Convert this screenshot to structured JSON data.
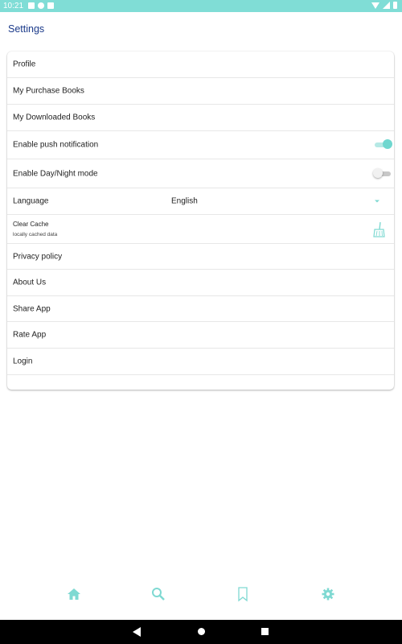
{
  "status_bar": {
    "time": "10:21"
  },
  "header": {
    "title": "Settings"
  },
  "settings": {
    "profile": "Profile",
    "purchase_books": "My Purchase Books",
    "downloaded_books": "My Downloaded Books",
    "push_notification": {
      "label": "Enable push notification",
      "enabled": true
    },
    "day_night_mode": {
      "label": "Enable Day/Night mode",
      "enabled": false
    },
    "language": {
      "label": "Language",
      "value": "English"
    },
    "clear_cache": {
      "title": "Clear Cache",
      "subtitle": "locally cached data"
    },
    "privacy_policy": "Privacy policy",
    "about_us": "About Us",
    "share_app": "Share App",
    "rate_app": "Rate App",
    "login": "Login"
  },
  "bottom_nav": {
    "items": [
      {
        "icon": "home-icon"
      },
      {
        "icon": "search-icon"
      },
      {
        "icon": "bookmark-icon"
      },
      {
        "icon": "gear-icon",
        "active": true
      }
    ]
  },
  "colors": {
    "accent": "#80ddd6",
    "title": "#1b3a8a",
    "icon": "#7fd9d2"
  }
}
